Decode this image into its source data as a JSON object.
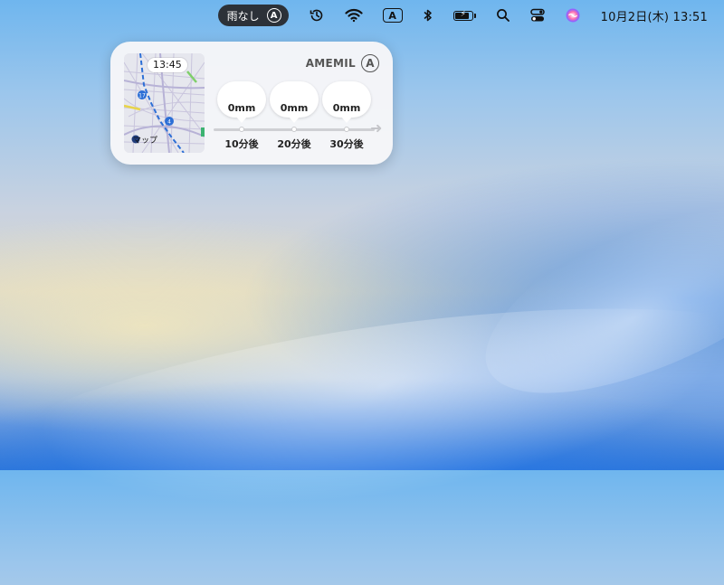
{
  "menubar": {
    "rain_status": "雨なし",
    "input_indicator": "A",
    "clock": "10月2日(木)  13:51"
  },
  "widget": {
    "brand": "AMEMIL",
    "brand_mark": "A",
    "map": {
      "time": "13:45",
      "label": "マップ"
    },
    "forecasts": [
      {
        "amount": "0mm",
        "label": "10分後"
      },
      {
        "amount": "0mm",
        "label": "20分後"
      },
      {
        "amount": "0mm",
        "label": "30分後"
      }
    ]
  },
  "icons": {
    "menubar": [
      "circled-a-icon",
      "time-machine-icon",
      "wifi-icon",
      "input-source-icon",
      "bluetooth-icon",
      "battery-icon",
      "search-icon",
      "control-center-icon",
      "siri-icon"
    ]
  },
  "colors": {
    "pill_bg": "#2c3138",
    "widget_bg": "#f6f6f8",
    "route_blue": "#2d6fd6"
  }
}
